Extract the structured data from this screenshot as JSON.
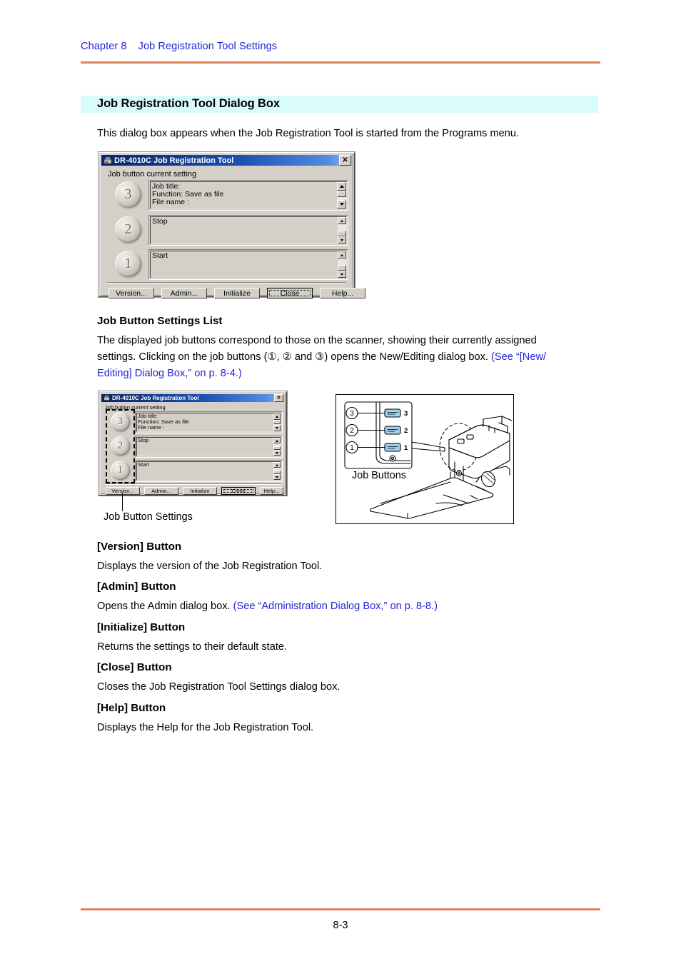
{
  "header": {
    "chapter": "Chapter 8",
    "title": "Job Registration Tool Settings"
  },
  "footer": {
    "page_number": "8-3"
  },
  "colors": {
    "rule": "#e08058",
    "heading_band": "#d9fbfb",
    "link": "#2323d8",
    "dialog_face": "#d4d0c8",
    "titlebar_start": "#0a246a",
    "titlebar_end": "#8fb6ef",
    "job_button_blue": "#9ed2ee"
  },
  "section": {
    "heading": "Job Registration Tool Dialog Box",
    "intro": "This dialog box appears when the Job Registration Tool is started from the Programs menu."
  },
  "dialog": {
    "title": "DR-4010C Job Registration Tool",
    "close_glyph": "✕",
    "group_label": "Job button current setting",
    "entries": [
      {
        "number": "3",
        "lines": [
          "Job title:",
          "Function: Save as file",
          "File name :"
        ]
      },
      {
        "number": "2",
        "lines": [
          "Stop"
        ]
      },
      {
        "number": "1",
        "lines": [
          "Start"
        ]
      }
    ],
    "buttons": [
      {
        "label": "Version...",
        "accel": "V",
        "focused": false
      },
      {
        "label": "Admin...",
        "accel": "A",
        "focused": false
      },
      {
        "label": "Initialize",
        "accel": "I",
        "focused": false
      },
      {
        "label": "Close",
        "accel": "C",
        "focused": true
      },
      {
        "label": "Help...",
        "accel": "H",
        "focused": false
      }
    ]
  },
  "job_button_list": {
    "heading": "Job Button Settings List",
    "body_line1": "The displayed job buttons correspond to those on the scanner, showing their currently assigned",
    "body_line2_a": "settings. Clicking on the job buttons (",
    "body_line2_b": ", ",
    "body_line2_c": " and ",
    "body_line2_d": ") opens the New/Editing dialog box. ",
    "circled_1": "①",
    "circled_2": "②",
    "circled_3": "③",
    "link_part1": "(See “[New/",
    "link_part2": "Editing] Dialog Box,” on p. 8-4.)"
  },
  "figures": {
    "dialog_caption": "Job Button Settings",
    "scanner_caption": "Job Buttons",
    "scanner_button_labels": [
      "3",
      "2",
      "1"
    ],
    "scanner_circled_labels": [
      "③",
      "②",
      "①"
    ]
  },
  "button_docs": [
    {
      "heading": "[Version] Button",
      "text": "Displays the version of the Job Registration Tool.",
      "link": ""
    },
    {
      "heading": "[Admin] Button",
      "text": "Opens the Admin dialog box. ",
      "link": "(See “Administration Dialog Box,” on p. 8-8.)"
    },
    {
      "heading": "[Initialize] Button",
      "text": "Returns the settings to their default state.",
      "link": ""
    },
    {
      "heading": "[Close] Button",
      "text": "Closes the Job Registration Tool Settings dialog box.",
      "link": ""
    },
    {
      "heading": "[Help] Button",
      "text": "Displays the Help for the Job Registration Tool.",
      "link": ""
    }
  ]
}
